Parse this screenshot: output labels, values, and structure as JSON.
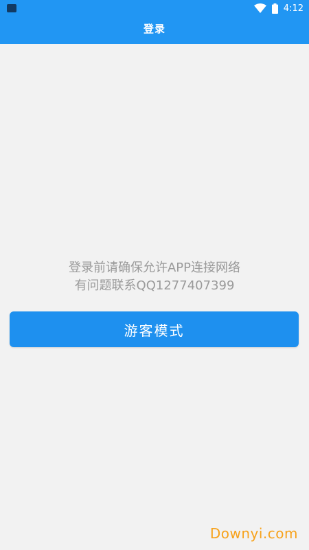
{
  "status_bar": {
    "time": "4:12",
    "icons": [
      "notification-icon",
      "wifi-icon",
      "battery-icon"
    ]
  },
  "app_bar": {
    "title": "登录"
  },
  "notice": {
    "line1": "登录前请确保允许APP连接网络",
    "line2": "有问题联系QQ1277407399"
  },
  "guest_button": {
    "label": "游客模式"
  },
  "watermark": {
    "text": "Downyi.com"
  },
  "colors": {
    "primary": "#2196f3",
    "button": "#1e90ef",
    "background": "#f2f2f2",
    "notice_text": "#9a9a9a",
    "watermark": "#f7a21b"
  }
}
